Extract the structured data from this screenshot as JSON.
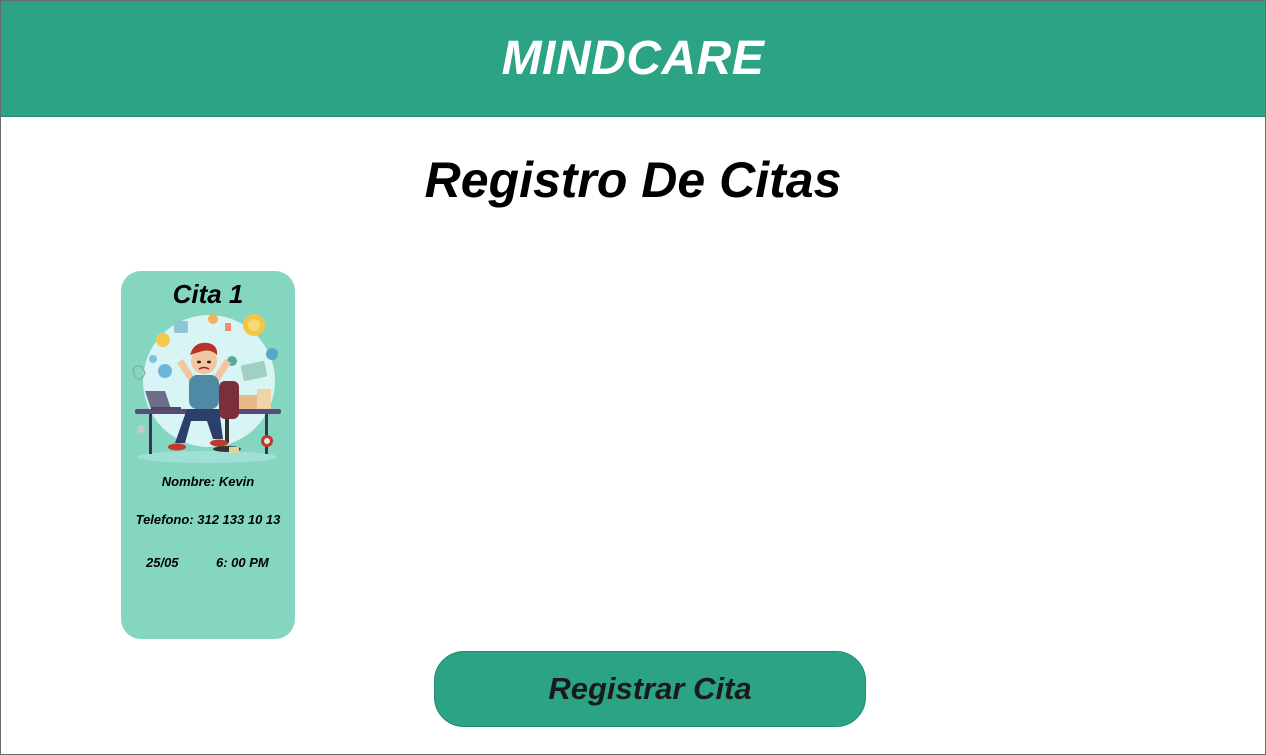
{
  "header": {
    "brand": "MINDCARE",
    "color": "#2ba384"
  },
  "page": {
    "title": "Registro De Citas"
  },
  "appointments": [
    {
      "title": "Cita 1",
      "illustration": "stressed-man-at-desk",
      "name_line": "Nombre: Kevin",
      "phone_line": "Telefono: 312 133 10 13",
      "date": "25/05",
      "time": "6: 00 PM",
      "card_color": "#84d6c1"
    }
  ],
  "actions": {
    "register_label": "Registrar Cita"
  }
}
